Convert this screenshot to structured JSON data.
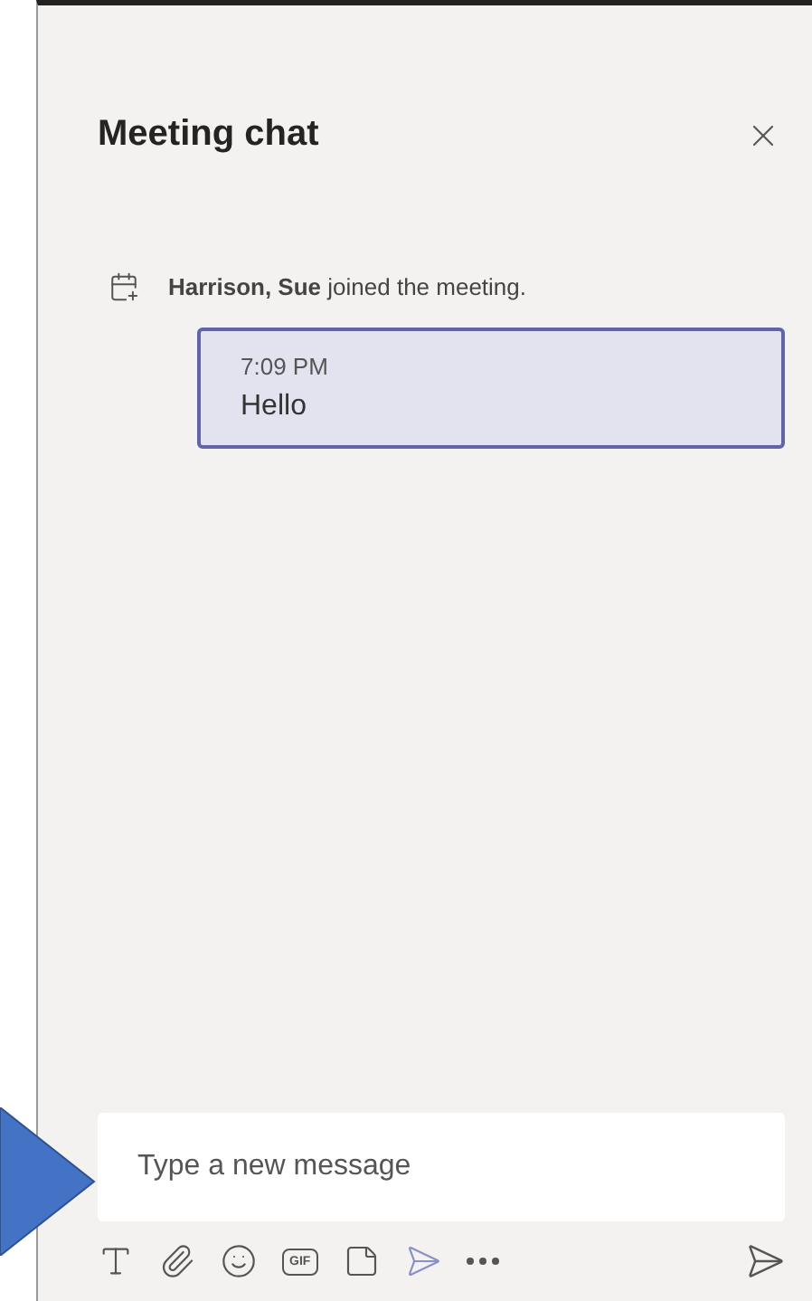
{
  "panel": {
    "title": "Meeting chat"
  },
  "events": [
    {
      "text": "**Harrison, Sue** joined the meeting."
    }
  ],
  "messages": [
    {
      "time": "7:09 PM",
      "text": "Hello",
      "selected": true
    }
  ],
  "composer": {
    "placeholder": "Type a new message"
  },
  "toolbar": [
    {
      "kind": "format"
    },
    {
      "kind": "attach"
    },
    {
      "kind": "emoji"
    },
    {
      "kind": "gif",
      "label": "GIF"
    },
    {
      "kind": "sticker"
    },
    {
      "kind": "stream"
    },
    {
      "kind": "more"
    }
  ]
}
